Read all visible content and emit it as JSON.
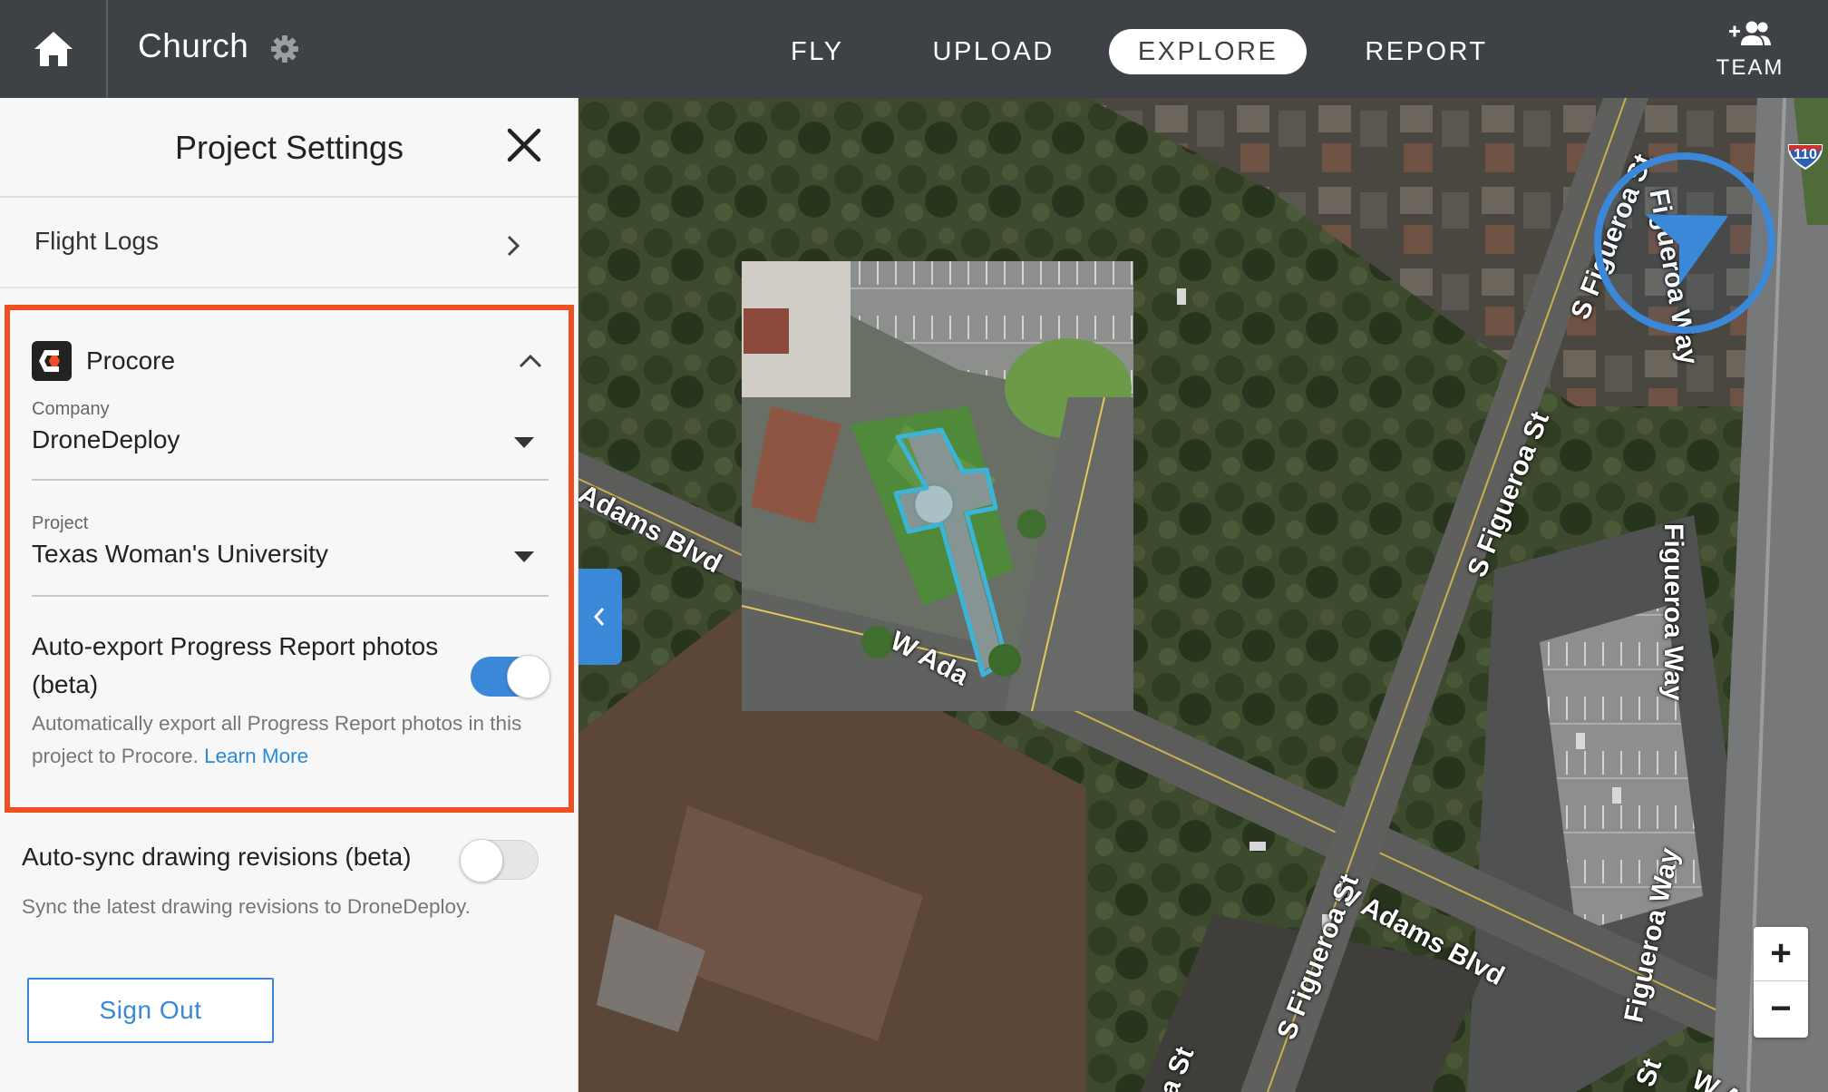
{
  "header": {
    "project_title": "Church",
    "tabs": [
      {
        "label": "FLY",
        "active": false
      },
      {
        "label": "UPLOAD",
        "active": false
      },
      {
        "label": "EXPLORE",
        "active": true
      },
      {
        "label": "REPORT",
        "active": false
      }
    ],
    "team_label": "TEAM"
  },
  "panel": {
    "title": "Project Settings",
    "flight_logs_label": "Flight Logs",
    "procore": {
      "name": "Procore",
      "company_label": "Company",
      "company_value": "DroneDeploy",
      "project_label": "Project",
      "project_value": "Texas Woman's University",
      "auto_export_title": "Auto-export Progress Report photos (beta)",
      "auto_export_desc": "Automatically export all Progress Report photos in this project to Procore.",
      "learn_more": "Learn More",
      "auto_export_on": true
    },
    "auto_sync_title": "Auto-sync drawing revisions (beta)",
    "auto_sync_desc": "Sync the latest drawing revisions to DroneDeploy.",
    "auto_sync_on": false,
    "sign_out_label": "Sign Out"
  },
  "map": {
    "street_labels": {
      "adams_blvd_left": "Adams Blvd",
      "w_adams_mid": "W Ada",
      "w_adams_blvd": "W Adams Blvd",
      "w_adams_right": "W Ad",
      "s_figueroa_top": "S Figueroa St",
      "s_figueroa_mid": "S Figueroa St",
      "s_figueroa_bottom": "S Figueroa St",
      "s_figueroa_edge": "a St",
      "figueroa_way_right": "Figueroa Way",
      "figueroa_way_bottom": "Figueroa Way",
      "figueroa_way_top": "Figueroa Way",
      "st_bottom_right": "St"
    },
    "highway_shield": "110",
    "zoom_in": "+",
    "zoom_out": "−"
  },
  "colors": {
    "topbar": "#3e4247",
    "accent": "#3b87d8",
    "procore_highlight": "#f04e23",
    "outline": "#3cb4d8"
  },
  "icons": [
    "home-icon",
    "gear-icon",
    "add-team-icon",
    "close-icon",
    "chevron-right-icon",
    "procore-logo-icon",
    "chevron-up-icon",
    "caret-down-icon",
    "chevron-left-icon",
    "compass-icon"
  ]
}
